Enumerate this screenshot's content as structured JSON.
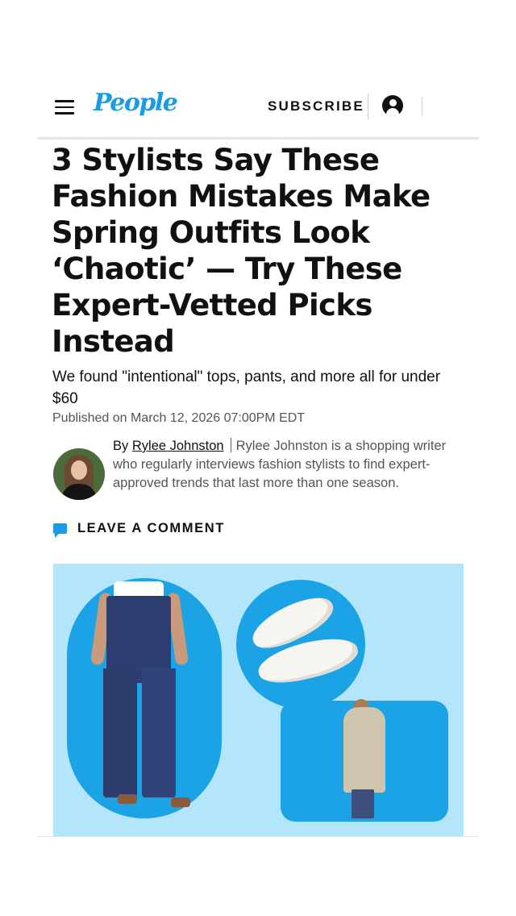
{
  "header": {
    "logo": "People",
    "subscribe_label": "SUBSCRIBE",
    "menu_icon": "hamburger-icon",
    "account_icon": "account-circle-icon",
    "brand_color": "#1a9be6"
  },
  "article": {
    "headline": "3 Stylists Say These Fashion Mistakes Make Spring Outfits Look ‘Chaotic’ — Try These Expert-Vetted Picks Instead",
    "subhead": "We found \"intentional\" tops, pants, and more all for under $60",
    "published": "Published on March 12, 2026 07:00PM EDT",
    "byline": {
      "prefix": "By",
      "author": "Rylee Johnston",
      "bio": "Rylee Johnston is a shopping writer who regularly interviews fashion stylists to find expert-approved trends that last more than one season."
    },
    "comment_label": "LEAVE A COMMENT",
    "comment_icon": "comment-bubble-icon"
  },
  "hero": {
    "background_color": "#b3e6fa",
    "panel_color": "#1ca3e6",
    "items": [
      "flare-jeans-image",
      "white-loafers-image",
      "trench-coat-image"
    ]
  }
}
